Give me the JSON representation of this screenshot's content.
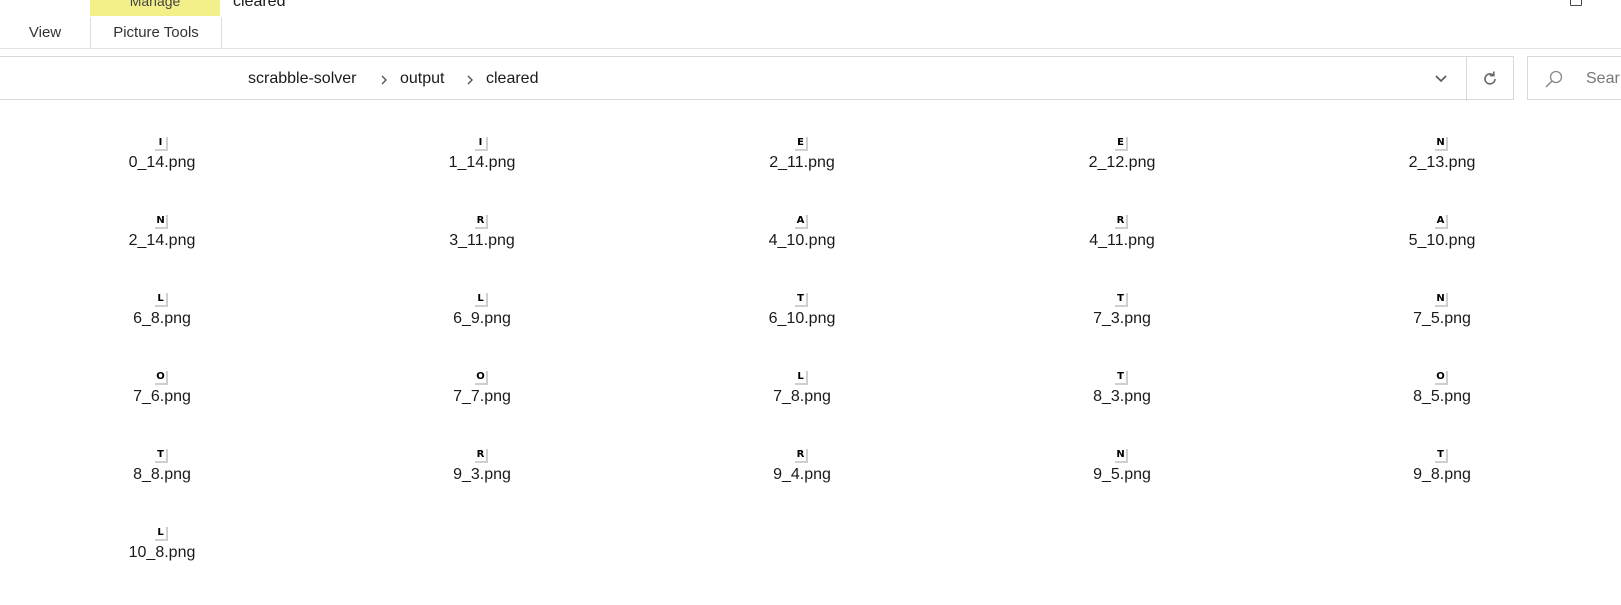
{
  "ribbon": {
    "context_group_label": "Manage",
    "title": "cleared",
    "tabs": [
      {
        "label": "View"
      },
      {
        "label": "Picture Tools"
      }
    ]
  },
  "address": {
    "breadcrumb": [
      "scrabble-solver",
      "output",
      "cleared"
    ]
  },
  "search": {
    "placeholder": "Sear"
  },
  "colors": {
    "context_tab_bg": "#f3f08a",
    "border": "#d9d9d9"
  },
  "files": [
    {
      "name": "0_14.png",
      "letter": "I"
    },
    {
      "name": "1_14.png",
      "letter": "I"
    },
    {
      "name": "2_11.png",
      "letter": "E"
    },
    {
      "name": "2_12.png",
      "letter": "E"
    },
    {
      "name": "2_13.png",
      "letter": "N"
    },
    {
      "name": "2_14.png",
      "letter": "N"
    },
    {
      "name": "3_11.png",
      "letter": "R"
    },
    {
      "name": "4_10.png",
      "letter": "A"
    },
    {
      "name": "4_11.png",
      "letter": "R"
    },
    {
      "name": "5_10.png",
      "letter": "A"
    },
    {
      "name": "6_8.png",
      "letter": "L"
    },
    {
      "name": "6_9.png",
      "letter": "L"
    },
    {
      "name": "6_10.png",
      "letter": "T"
    },
    {
      "name": "7_3.png",
      "letter": "T"
    },
    {
      "name": "7_5.png",
      "letter": "N"
    },
    {
      "name": "7_6.png",
      "letter": "O"
    },
    {
      "name": "7_7.png",
      "letter": "O"
    },
    {
      "name": "7_8.png",
      "letter": "L"
    },
    {
      "name": "8_3.png",
      "letter": "T"
    },
    {
      "name": "8_5.png",
      "letter": "O"
    },
    {
      "name": "8_8.png",
      "letter": "T"
    },
    {
      "name": "9_3.png",
      "letter": "R"
    },
    {
      "name": "9_4.png",
      "letter": "R"
    },
    {
      "name": "9_5.png",
      "letter": "N"
    },
    {
      "name": "9_8.png",
      "letter": "T"
    },
    {
      "name": "10_8.png",
      "letter": "L"
    }
  ]
}
